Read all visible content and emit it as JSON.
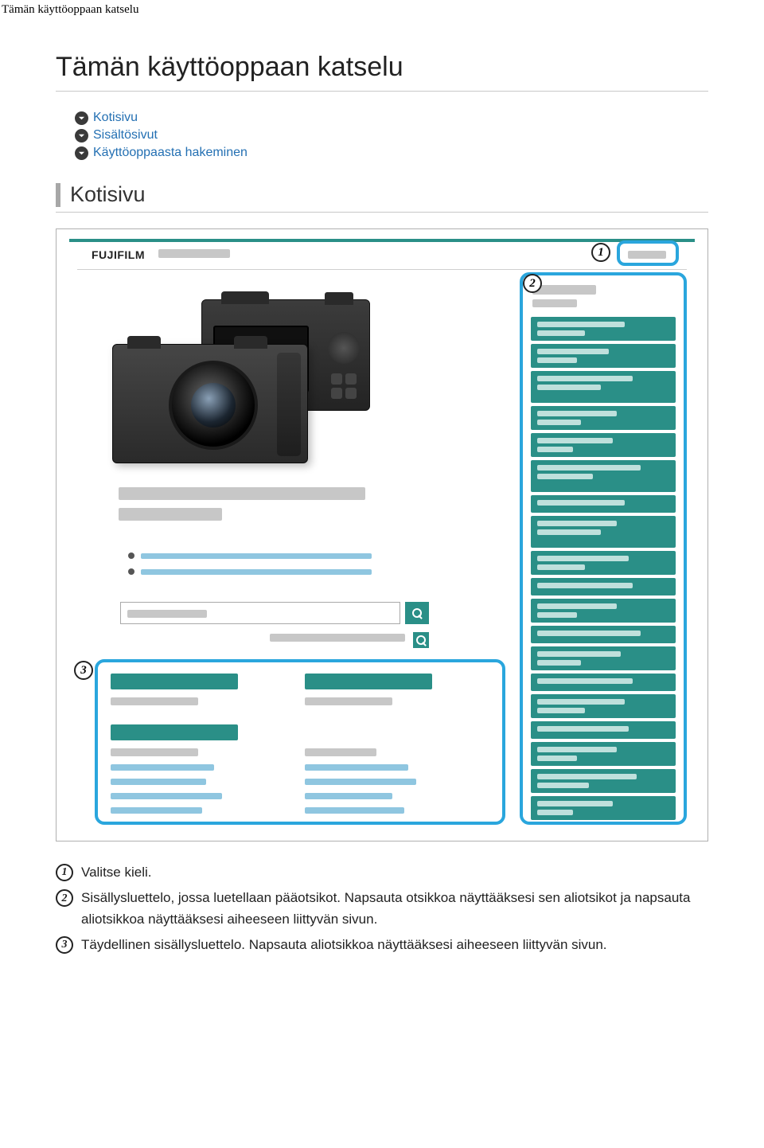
{
  "header_small": "Tämän käyttöoppaan katselu",
  "page_title": "Tämän käyttöoppaan katselu",
  "links": {
    "home": "Kotisivu",
    "contents": "Sisältösivut",
    "search": "Käyttöoppaasta hakeminen"
  },
  "section_heading": "Kotisivu",
  "diagram": {
    "logo": "FUJIFILM",
    "callout_1": "1",
    "callout_2": "2",
    "callout_3": "3"
  },
  "legend": {
    "n1": "1",
    "t1": "Valitse kieli.",
    "n2": "2",
    "t2": "Sisällysluettelo, jossa luetellaan pääotsikot. Napsauta otsikkoa näyttääksesi sen aliotsikot ja napsauta aliotsikkoa näyttääksesi aiheeseen liittyvän sivun.",
    "n3": "3",
    "t3": "Täydellinen sisällysluettelo. Napsauta aliotsikkoa näyttääksesi aiheeseen liittyvän sivun."
  }
}
